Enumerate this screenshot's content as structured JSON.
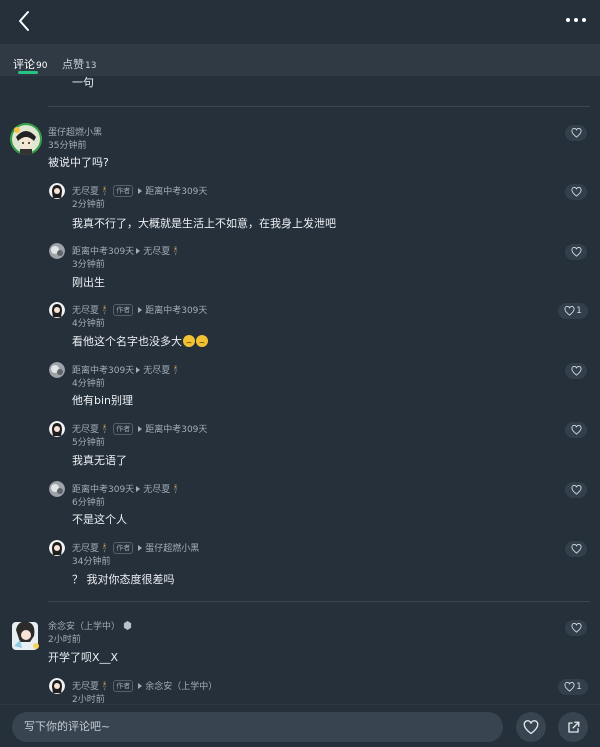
{
  "tabs": [
    {
      "label": "评论",
      "count": "90"
    },
    {
      "label": "点赞",
      "count": "13"
    }
  ],
  "previous_comment_tail": "一句",
  "threads": [
    {
      "name": "蛋仔超燃小黑",
      "time": "35分钟前",
      "text": "被说中了吗?",
      "replies": [
        {
          "name": "无尽夏🕴",
          "author_tag": "作者",
          "reply_to": "距离中考309天",
          "time": "2分钟前",
          "text": "我真不行了，大概就是生活上不如意，在我身上发泄吧",
          "likes": ""
        },
        {
          "name": "距离中考309天",
          "author_tag": "",
          "reply_to": "无尽夏🕴",
          "time": "3分钟前",
          "text": "刚出生",
          "likes": ""
        },
        {
          "name": "无尽夏🕴",
          "author_tag": "作者",
          "reply_to": "距离中考309天",
          "time": "4分钟前",
          "text": "看他这个名字也没多大",
          "likes": "1"
        },
        {
          "name": "距离中考309天",
          "author_tag": "",
          "reply_to": "无尽夏🕴",
          "time": "4分钟前",
          "text": "他有bin别理",
          "likes": ""
        },
        {
          "name": "无尽夏🕴",
          "author_tag": "作者",
          "reply_to": "距离中考309天",
          "time": "5分钟前",
          "text": "我真无语了",
          "likes": ""
        },
        {
          "name": "距离中考309天",
          "author_tag": "",
          "reply_to": "无尽夏🕴",
          "time": "6分钟前",
          "text": "不是这个人",
          "likes": ""
        },
        {
          "name": "无尽夏🕴",
          "author_tag": "作者",
          "reply_to": "蛋仔超燃小黑",
          "time": "34分钟前",
          "text": "？ 我对你态度很差吗",
          "likes": ""
        }
      ]
    },
    {
      "name": "余念安（上学中）",
      "time": "2小时前",
      "text": "开学了呗X__X",
      "replies": [
        {
          "name": "无尽夏🕴",
          "author_tag": "作者",
          "reply_to": "余念安（上学中）",
          "time": "2小时前",
          "text": "",
          "likes": "1"
        }
      ]
    }
  ],
  "bottom_bar": {
    "placeholder": "写下你的评论吧~"
  },
  "icons": [
    "back-arrow-icon",
    "more-icon",
    "heart-icon",
    "share-icon",
    "verified-badge-icon",
    "emoji-icon"
  ],
  "colors": {
    "background": "#25303b",
    "tab_bar": "#2f3a45",
    "accent": "#25c481"
  }
}
